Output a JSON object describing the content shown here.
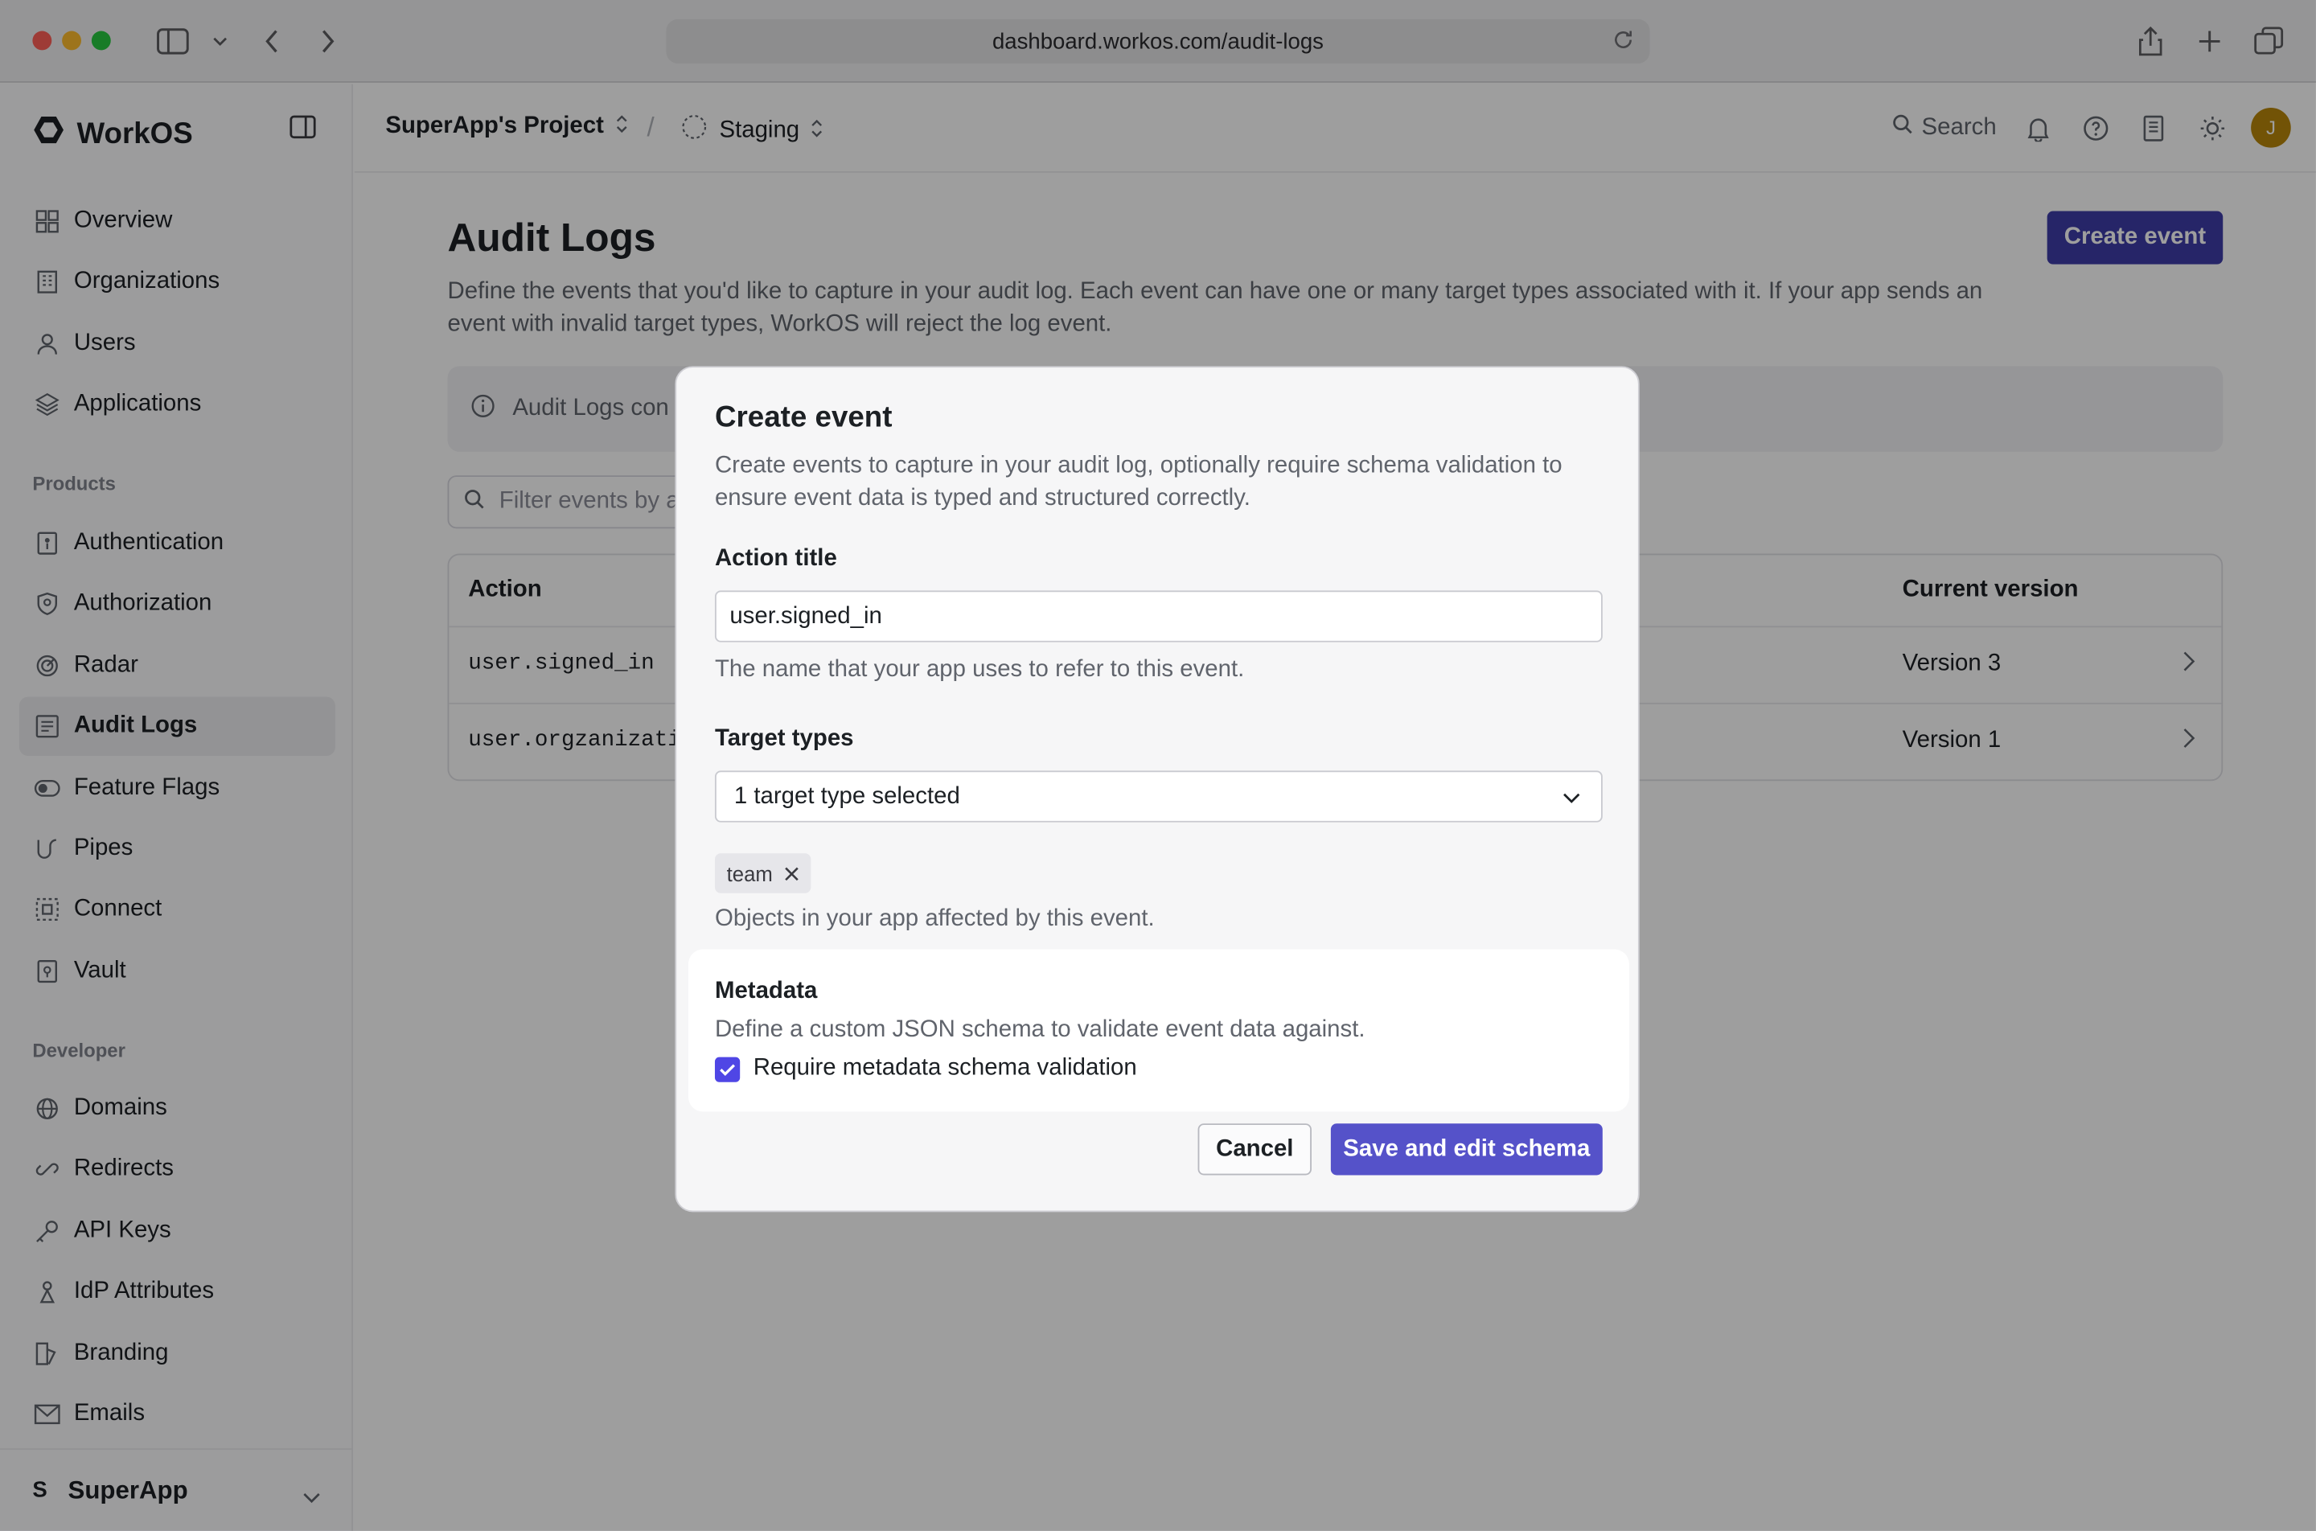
{
  "browser": {
    "url": "dashboard.workos.com/audit-logs"
  },
  "sidebar": {
    "brand": "WorkOS",
    "items_main": [
      {
        "label": "Overview",
        "icon": "grid-icon"
      },
      {
        "label": "Organizations",
        "icon": "building-icon"
      },
      {
        "label": "Users",
        "icon": "user-icon"
      },
      {
        "label": "Applications",
        "icon": "layers-icon"
      }
    ],
    "section_products": "Products",
    "items_products": [
      {
        "label": "Authentication",
        "icon": "key-icon"
      },
      {
        "label": "Authorization",
        "icon": "shield-icon"
      },
      {
        "label": "Radar",
        "icon": "radar-icon"
      },
      {
        "label": "Audit Logs",
        "icon": "list-icon",
        "active": true
      },
      {
        "label": "Feature Flags",
        "icon": "toggle-icon"
      },
      {
        "label": "Pipes",
        "icon": "pipes-icon"
      },
      {
        "label": "Connect",
        "icon": "connect-icon"
      },
      {
        "label": "Vault",
        "icon": "vault-icon"
      }
    ],
    "section_developer": "Developer",
    "items_developer": [
      {
        "label": "Domains",
        "icon": "globe-icon"
      },
      {
        "label": "Redirects",
        "icon": "link-icon"
      },
      {
        "label": "API Keys",
        "icon": "api-key-icon"
      },
      {
        "label": "IdP Attributes",
        "icon": "attributes-icon"
      },
      {
        "label": "Branding",
        "icon": "palette-icon"
      },
      {
        "label": "Emails",
        "icon": "mail-icon"
      }
    ],
    "team": {
      "initial": "S",
      "name": "SuperApp"
    }
  },
  "topbar": {
    "project": "SuperApp's Project",
    "environment": "Staging",
    "search_label": "Search",
    "avatar_initial": "J"
  },
  "page": {
    "title": "Audit Logs",
    "create_button": "Create event",
    "description": "Define the events that you'd like to capture in your audit log. Each event can have one or many target types associated with it. If your app sends an event with invalid target types, WorkOS will reject the log event.",
    "callout_text": "Audit Logs con",
    "filter_placeholder": "Filter events by a"
  },
  "table": {
    "headers": {
      "action": "Action",
      "version": "Current version"
    },
    "rows": [
      {
        "action": "user.signed_in",
        "version": "Version 3"
      },
      {
        "action": "user.orgzanizatio",
        "version": "Version 1"
      }
    ]
  },
  "modal": {
    "title": "Create event",
    "description": "Create events to capture in your audit log, optionally require schema validation to ensure event data is typed and structured correctly.",
    "action_title_label": "Action title",
    "action_title_value": "user.signed_in",
    "action_title_help": "The name that your app uses to refer to this event.",
    "target_types_label": "Target types",
    "target_types_value": "1 target type selected",
    "target_chip": "team",
    "target_types_help": "Objects in your app affected by this event.",
    "metadata_title": "Metadata",
    "metadata_desc": "Define a custom JSON schema to validate event data against.",
    "metadata_checkbox_label": "Require metadata schema validation",
    "metadata_checked": true,
    "cancel_label": "Cancel",
    "save_label": "Save and edit schema"
  },
  "colors": {
    "primary": "#3e3ca8",
    "save_button": "#5552c9",
    "checkbox": "#4f46e5"
  }
}
